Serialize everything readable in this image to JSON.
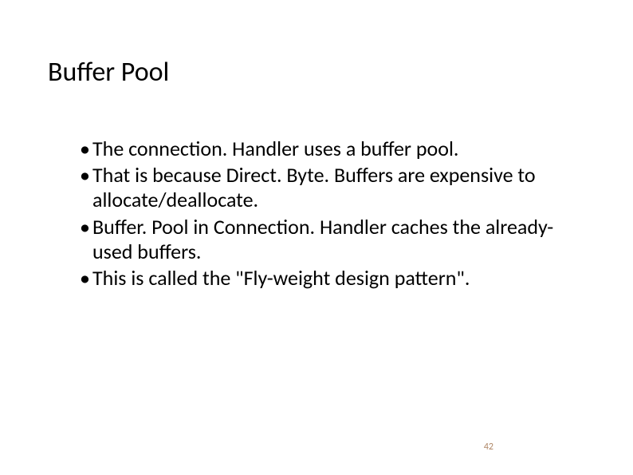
{
  "title": "Buffer Pool",
  "bullets": [
    "The connection. Handler uses a buffer pool.",
    "That is because Direct. Byte. Buffers are expensive to allocate/deallocate.",
    "Buffer. Pool in Connection. Handler caches the already-used buffers.",
    "This is called the \"Fly-weight design pattern\"."
  ],
  "pageNumber": "42"
}
